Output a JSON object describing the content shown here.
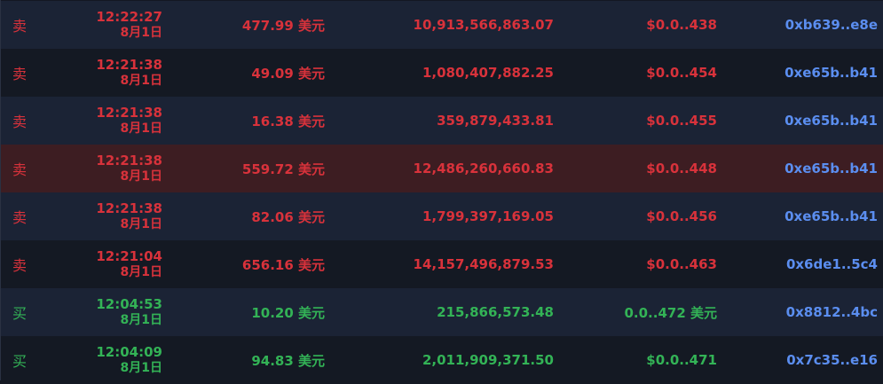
{
  "trades": [
    {
      "side": "卖",
      "time": "12:22:27",
      "date": "8月1日",
      "usd": "477.99 美元",
      "amount": "10,913,566,863.07",
      "price": "$0.0..438",
      "maker": "0xb639..e8e",
      "type": "sell",
      "highlight": false
    },
    {
      "side": "卖",
      "time": "12:21:38",
      "date": "8月1日",
      "usd": "49.09 美元",
      "amount": "1,080,407,882.25",
      "price": "$0.0..454",
      "maker": "0xe65b..b41",
      "type": "sell",
      "highlight": false
    },
    {
      "side": "卖",
      "time": "12:21:38",
      "date": "8月1日",
      "usd": "16.38 美元",
      "amount": "359,879,433.81",
      "price": "$0.0..455",
      "maker": "0xe65b..b41",
      "type": "sell",
      "highlight": false
    },
    {
      "side": "卖",
      "time": "12:21:38",
      "date": "8月1日",
      "usd": "559.72 美元",
      "amount": "12,486,260,660.83",
      "price": "$0.0..448",
      "maker": "0xe65b..b41",
      "type": "sell",
      "highlight": true
    },
    {
      "side": "卖",
      "time": "12:21:38",
      "date": "8月1日",
      "usd": "82.06 美元",
      "amount": "1,799,397,169.05",
      "price": "$0.0..456",
      "maker": "0xe65b..b41",
      "type": "sell",
      "highlight": false
    },
    {
      "side": "卖",
      "time": "12:21:04",
      "date": "8月1日",
      "usd": "656.16 美元",
      "amount": "14,157,496,879.53",
      "price": "$0.0..463",
      "maker": "0x6de1..5c4",
      "type": "sell",
      "highlight": false
    },
    {
      "side": "买",
      "time": "12:04:53",
      "date": "8月1日",
      "usd": "10.20 美元",
      "amount": "215,866,573.48",
      "price": "0.0..472 美元",
      "maker": "0x8812..4bc",
      "type": "buy",
      "highlight": false
    },
    {
      "side": "买",
      "time": "12:04:09",
      "date": "8月1日",
      "usd": "94.83 美元",
      "amount": "2,011,909,371.50",
      "price": "$0.0..471",
      "maker": "0x7c35..e16",
      "type": "buy",
      "highlight": false
    }
  ],
  "colors": {
    "sell": "#d8323b",
    "buy": "#33b356",
    "maker": "#5b8ef0",
    "highlight_row": "#3d1d22"
  }
}
